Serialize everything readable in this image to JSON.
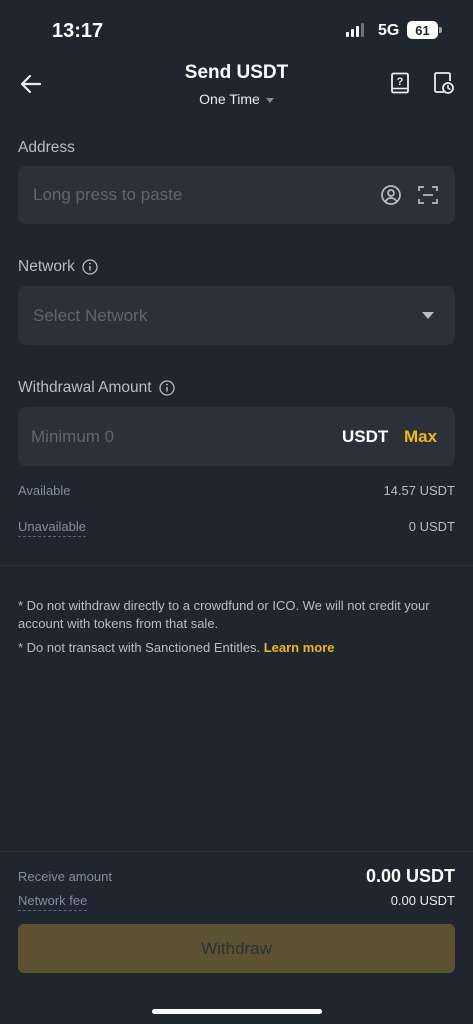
{
  "status_bar": {
    "time": "13:17",
    "network": "5G",
    "battery": "61"
  },
  "header": {
    "title": "Send USDT",
    "subtitle": "One Time"
  },
  "address": {
    "label": "Address",
    "placeholder": "Long press to paste"
  },
  "network": {
    "label": "Network",
    "placeholder": "Select Network"
  },
  "amount": {
    "label": "Withdrawal Amount",
    "placeholder": "Minimum 0",
    "currency": "USDT",
    "max_label": "Max"
  },
  "balances": {
    "available_label": "Available",
    "available_value": "14.57 USDT",
    "unavailable_label": "Unavailable",
    "unavailable_value": "0 USDT"
  },
  "notes": {
    "note1": "* Do not withdraw directly to a crowdfund or ICO. We will not credit your account with tokens from that sale.",
    "note2_text": "* Do not transact with Sanctioned Entitles. ",
    "note2_link": "Learn more"
  },
  "summary": {
    "receive_label": "Receive amount",
    "receive_value": "0.00 USDT",
    "fee_label": "Network fee",
    "fee_value": "0.00 USDT"
  },
  "withdraw_button": "Withdraw",
  "colors": {
    "background": "#1f2630",
    "field": "#2b3139",
    "accent": "#f0b90b",
    "button_disabled": "#5c5130"
  },
  "icons": [
    "back-arrow-icon",
    "help-book-icon",
    "history-icon",
    "contact-icon",
    "scan-icon",
    "info-icon",
    "dropdown-triangle-icon"
  ]
}
